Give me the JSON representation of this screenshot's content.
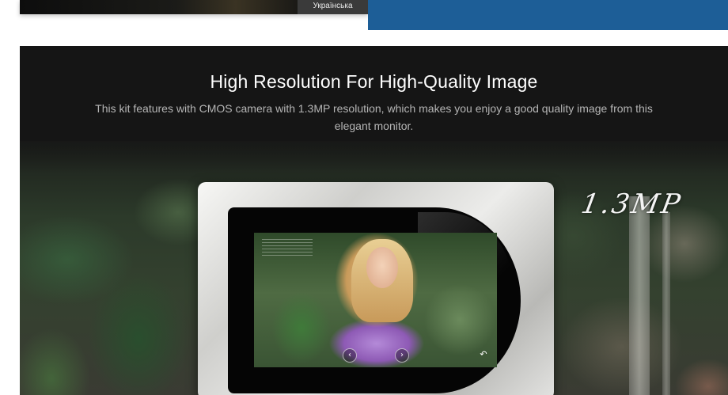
{
  "top_strip": {
    "language_label": "Українська"
  },
  "hero": {
    "title": "High Resolution For High-Quality Image",
    "description": "This kit features with CMOS camera with 1.3MP resolution, which makes you enjoy a good quality image from this elegant monitor.",
    "badge": "1.3MP"
  },
  "monitor": {
    "prev_icon": "chevron-left-icon",
    "next_icon": "chevron-right-icon",
    "back_icon": "back-arrow-icon"
  },
  "colors": {
    "accent_blue": "#1d5e97",
    "panel_dark": "#151515"
  }
}
